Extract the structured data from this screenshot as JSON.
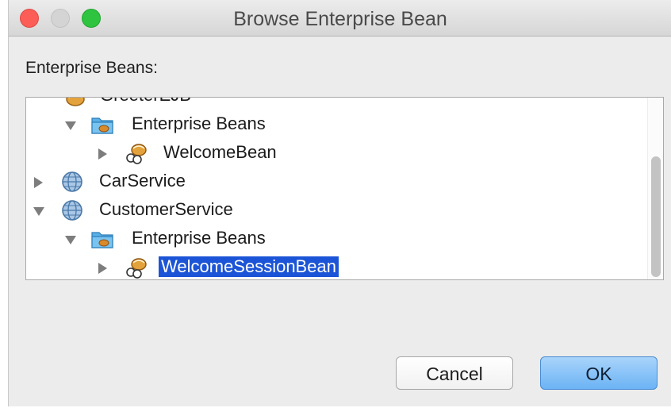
{
  "window": {
    "title": "Browse Enterprise Bean",
    "controls": [
      "close",
      "minimize",
      "zoom"
    ]
  },
  "section_label": "Enterprise Beans:",
  "tree": {
    "nodes": [
      {
        "label": "GreeterEJB",
        "icon": "jar-bean-icon",
        "expanded": true,
        "depth": 1,
        "note": "partially scrolled out of view"
      },
      {
        "label": "Enterprise Beans",
        "icon": "bean-folder-icon",
        "expanded": true,
        "depth": 2
      },
      {
        "label": "WelcomeBean",
        "icon": "session-bean-icon",
        "expanded": false,
        "depth": 3
      },
      {
        "label": "CarService",
        "icon": "globe-icon",
        "expanded": false,
        "depth": 1
      },
      {
        "label": "CustomerService",
        "icon": "globe-icon",
        "expanded": true,
        "depth": 1
      },
      {
        "label": "Enterprise Beans",
        "icon": "bean-folder-icon",
        "expanded": true,
        "depth": 2
      },
      {
        "label": "WelcomeSessionBean",
        "icon": "session-bean-icon",
        "expanded": false,
        "depth": 3,
        "selected": true
      }
    ]
  },
  "buttons": {
    "cancel": "Cancel",
    "ok": "OK"
  },
  "colors": {
    "selection": "#1b54d6",
    "default_button": "#6cb3f5"
  }
}
